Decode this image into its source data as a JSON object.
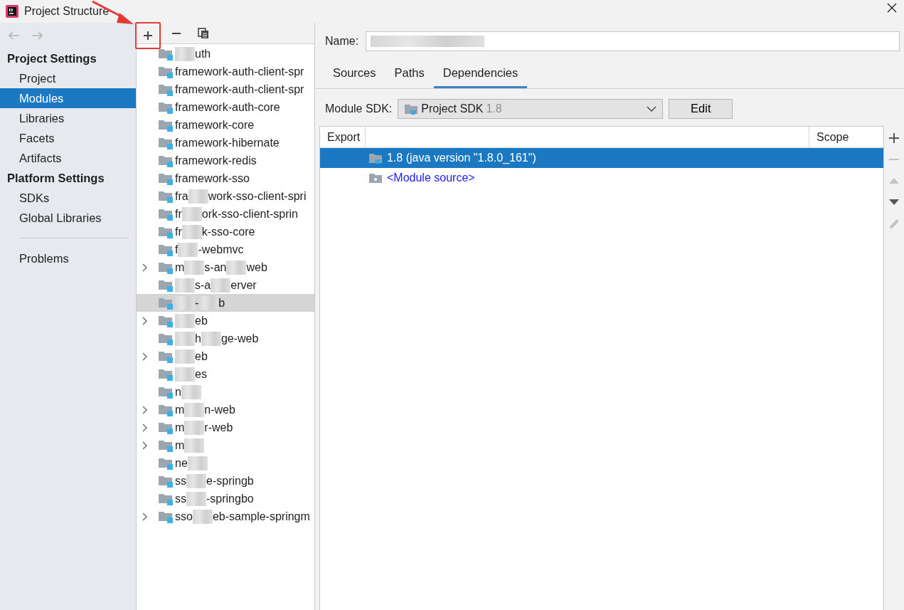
{
  "window": {
    "title": "Project Structure"
  },
  "nav": [
    {
      "kind": "back",
      "disabled": true
    },
    {
      "kind": "forward",
      "disabled": true
    }
  ],
  "sidebar": {
    "sections": [
      {
        "title": "Project Settings",
        "items": [
          {
            "label": "Project",
            "selected": false
          },
          {
            "label": "Modules",
            "selected": true
          },
          {
            "label": "Libraries",
            "selected": false
          },
          {
            "label": "Facets",
            "selected": false
          },
          {
            "label": "Artifacts",
            "selected": false
          }
        ]
      },
      {
        "title": "Platform Settings",
        "items": [
          {
            "label": "SDKs",
            "selected": false
          },
          {
            "label": "Global Libraries",
            "selected": false
          }
        ]
      }
    ],
    "extra_items": [
      {
        "label": "Problems",
        "selected": false
      }
    ]
  },
  "module_toolbar": [
    {
      "kind": "add",
      "highlighted": true
    },
    {
      "kind": "remove",
      "highlighted": false
    },
    {
      "kind": "copy",
      "highlighted": false
    }
  ],
  "modules": [
    {
      "expandable": false,
      "selected": false,
      "parts": [
        {
          "kind": "blur"
        },
        {
          "kind": "text",
          "text": "uth"
        }
      ]
    },
    {
      "expandable": false,
      "selected": false,
      "parts": [
        {
          "kind": "text",
          "text": "framework-auth-client-spr"
        }
      ]
    },
    {
      "expandable": false,
      "selected": false,
      "parts": [
        {
          "kind": "text",
          "text": "framework-auth-client-spr"
        }
      ]
    },
    {
      "expandable": false,
      "selected": false,
      "parts": [
        {
          "kind": "text",
          "text": "framework-auth-core"
        }
      ]
    },
    {
      "expandable": false,
      "selected": false,
      "parts": [
        {
          "kind": "text",
          "text": "framework-core"
        }
      ]
    },
    {
      "expandable": false,
      "selected": false,
      "parts": [
        {
          "kind": "text",
          "text": "framework-hibernate"
        }
      ]
    },
    {
      "expandable": false,
      "selected": false,
      "parts": [
        {
          "kind": "text",
          "text": "framework-redis"
        }
      ]
    },
    {
      "expandable": false,
      "selected": false,
      "parts": [
        {
          "kind": "text",
          "text": "framework-sso"
        }
      ]
    },
    {
      "expandable": false,
      "selected": false,
      "parts": [
        {
          "kind": "text",
          "text": "fra"
        },
        {
          "kind": "blur"
        },
        {
          "kind": "text",
          "text": "work-sso-client-spri"
        }
      ]
    },
    {
      "expandable": false,
      "selected": false,
      "parts": [
        {
          "kind": "text",
          "text": "fr"
        },
        {
          "kind": "blur"
        },
        {
          "kind": "text",
          "text": "ork-sso-client-sprin"
        }
      ]
    },
    {
      "expandable": false,
      "selected": false,
      "parts": [
        {
          "kind": "text",
          "text": "fr"
        },
        {
          "kind": "blur"
        },
        {
          "kind": "text",
          "text": "k-sso-core"
        }
      ]
    },
    {
      "expandable": false,
      "selected": false,
      "parts": [
        {
          "kind": "text",
          "text": "f"
        },
        {
          "kind": "blur"
        },
        {
          "kind": "text",
          "text": "-webmvc"
        }
      ]
    },
    {
      "expandable": true,
      "selected": false,
      "parts": [
        {
          "kind": "text",
          "text": "m"
        },
        {
          "kind": "blur"
        },
        {
          "kind": "text",
          "text": "s-an"
        },
        {
          "kind": "blur"
        },
        {
          "kind": "text",
          "text": "web"
        }
      ]
    },
    {
      "expandable": false,
      "selected": false,
      "parts": [
        {
          "kind": "blur"
        },
        {
          "kind": "text",
          "text": "s-a"
        },
        {
          "kind": "blur"
        },
        {
          "kind": "text",
          "text": "erver"
        }
      ]
    },
    {
      "expandable": false,
      "selected": true,
      "parts": [
        {
          "kind": "blur"
        },
        {
          "kind": "text",
          "text": "-"
        },
        {
          "kind": "blur"
        },
        {
          "kind": "text",
          "text": "b"
        }
      ]
    },
    {
      "expandable": true,
      "selected": false,
      "parts": [
        {
          "kind": "blur"
        },
        {
          "kind": "text",
          "text": "eb"
        }
      ]
    },
    {
      "expandable": false,
      "selected": false,
      "parts": [
        {
          "kind": "blur"
        },
        {
          "kind": "text",
          "text": "h"
        },
        {
          "kind": "blur"
        },
        {
          "kind": "text",
          "text": "ge-web"
        }
      ]
    },
    {
      "expandable": true,
      "selected": false,
      "parts": [
        {
          "kind": "blur"
        },
        {
          "kind": "text",
          "text": "eb"
        }
      ]
    },
    {
      "expandable": false,
      "selected": false,
      "parts": [
        {
          "kind": "blur"
        },
        {
          "kind": "text",
          "text": "es"
        }
      ]
    },
    {
      "expandable": false,
      "selected": false,
      "parts": [
        {
          "kind": "text",
          "text": "n"
        },
        {
          "kind": "blur"
        }
      ]
    },
    {
      "expandable": true,
      "selected": false,
      "parts": [
        {
          "kind": "text",
          "text": "m"
        },
        {
          "kind": "blur"
        },
        {
          "kind": "text",
          "text": "n-web"
        }
      ]
    },
    {
      "expandable": true,
      "selected": false,
      "parts": [
        {
          "kind": "text",
          "text": "m"
        },
        {
          "kind": "blur"
        },
        {
          "kind": "text",
          "text": "r-web"
        }
      ]
    },
    {
      "expandable": true,
      "selected": false,
      "parts": [
        {
          "kind": "text",
          "text": "m"
        },
        {
          "kind": "blur"
        }
      ]
    },
    {
      "expandable": false,
      "selected": false,
      "parts": [
        {
          "kind": "text",
          "text": "ne"
        },
        {
          "kind": "blur"
        }
      ]
    },
    {
      "expandable": false,
      "selected": false,
      "parts": [
        {
          "kind": "text",
          "text": "ss"
        },
        {
          "kind": "blur"
        },
        {
          "kind": "text",
          "text": "e-springb"
        }
      ]
    },
    {
      "expandable": false,
      "selected": false,
      "parts": [
        {
          "kind": "text",
          "text": "ss"
        },
        {
          "kind": "blur"
        },
        {
          "kind": "text",
          "text": "-springbo"
        }
      ]
    },
    {
      "expandable": true,
      "selected": false,
      "parts": [
        {
          "kind": "text",
          "text": "sso"
        },
        {
          "kind": "blur"
        },
        {
          "kind": "text",
          "text": "eb-sample-springm"
        }
      ]
    }
  ],
  "detail": {
    "name_label": "Name:",
    "name_redacted": true,
    "tabs": [
      {
        "label": "Sources",
        "selected": false
      },
      {
        "label": "Paths",
        "selected": false
      },
      {
        "label": "Dependencies",
        "selected": true
      }
    ],
    "sdk_label": "Module SDK:",
    "sdk_value": "Project SDK",
    "sdk_version": "1.8",
    "edit_button": "Edit",
    "table": {
      "columns": [
        "Export",
        "Scope"
      ],
      "rows": [
        {
          "kind": "sdk",
          "text": "1.8 (java version \"1.8.0_161\")",
          "selected": true
        },
        {
          "kind": "source",
          "text": "<Module source>",
          "selected": false
        }
      ]
    },
    "side_toolbar": [
      {
        "kind": "add",
        "disabled": false
      },
      {
        "kind": "remove",
        "disabled": true
      },
      {
        "kind": "up",
        "disabled": true
      },
      {
        "kind": "down",
        "disabled": false
      },
      {
        "kind": "edit",
        "disabled": true
      }
    ]
  }
}
